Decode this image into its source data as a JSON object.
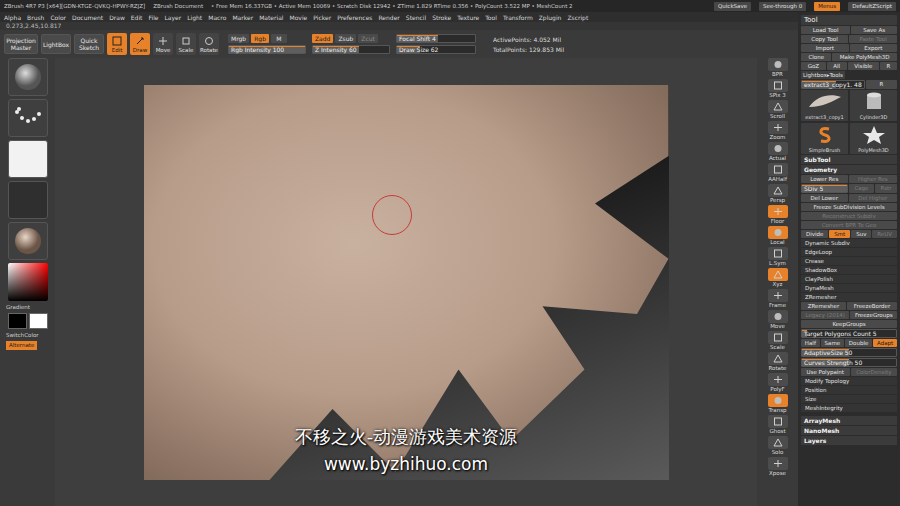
{
  "title_bar": {
    "info": [
      "ZBrush 4R7 P3 [x64][GDN-KTGE-QVKQ-HPWY-RZJZ]",
      "ZBrush Document",
      "• Free Mem 16.337GB • Active Mem 10069 • Scratch Disk 12942 • ZTime 1.829 RTime 0.356 • PolyCount 3.522 MP • MeshCount 2"
    ],
    "buttons": [
      {
        "label": "QuickSave",
        "selected": false
      },
      {
        "label": "See-through 0",
        "selected": false
      },
      {
        "label": "Menus",
        "selected": true
      },
      {
        "label": "DefaultZScript",
        "selected": false
      }
    ]
  },
  "menus": [
    "Alpha",
    "Brush",
    "Color",
    "Document",
    "Draw",
    "Edit",
    "File",
    "Layer",
    "Light",
    "Macro",
    "Marker",
    "Material",
    "Movie",
    "Picker",
    "Preferences",
    "Render",
    "Stencil",
    "Stroke",
    "Texture",
    "Tool",
    "Transform",
    "Zplugin",
    "Zscript"
  ],
  "coordinates": "0.273,2.45,10.817",
  "toolbar": {
    "buttons": [
      {
        "label": "Projection Master",
        "selected": false
      },
      {
        "label": "LightBox",
        "selected": false
      },
      {
        "label": "Quick Sketch",
        "selected": false
      }
    ],
    "modes": [
      {
        "label": "Edit",
        "selected": true
      },
      {
        "label": "Draw",
        "selected": true
      },
      {
        "label": "Move",
        "selected": false
      },
      {
        "label": "Scale",
        "selected": false
      },
      {
        "label": "Rotate",
        "selected": false
      }
    ],
    "color_modes": [
      {
        "label": "Mrgb",
        "selected": false,
        "disabled": false
      },
      {
        "label": "Rgb",
        "selected": true,
        "disabled": false
      },
      {
        "label": "M",
        "selected": false,
        "disabled": false
      }
    ],
    "z_modes": [
      {
        "label": "Zadd",
        "selected": true,
        "disabled": false
      },
      {
        "label": "Zsub",
        "selected": false,
        "disabled": false
      },
      {
        "label": "Zcut",
        "selected": false,
        "disabled": true
      }
    ],
    "focal_shift": {
      "label": "Focal Shift 4",
      "level": 0.52
    },
    "rgb_intensity": {
      "label": "Rgb Intensity 100",
      "level": 1
    },
    "z_intensity": {
      "label": "Z Intensity 60",
      "level": 0.6
    },
    "draw_size": {
      "label": "Draw Size 62",
      "level": 0.3
    },
    "stats": [
      "ActivePoints: 4.052 Mil",
      "TotalPoints: 129.853 Mil"
    ]
  },
  "left_shelf": {
    "gradient_label": "Gradient",
    "switch_label": "SwitchColor",
    "alternate": {
      "label": "Alternate",
      "selected": true
    }
  },
  "viewport": {
    "watermark": [
      "不移之火-动漫游戏美术资源",
      "www.byzhihuo.com"
    ]
  },
  "right_shelf": [
    {
      "label": "BPR",
      "selected": false
    },
    {
      "label": "SPix 3",
      "selected": false
    },
    {
      "label": "Scroll",
      "selected": false
    },
    {
      "label": "Zoom",
      "selected": false
    },
    {
      "label": "Actual",
      "selected": false
    },
    {
      "label": "AAHalf",
      "selected": false
    },
    {
      "label": "Persp",
      "selected": false
    },
    {
      "label": "Floor",
      "selected": true
    },
    {
      "label": "Local",
      "selected": true
    },
    {
      "label": "L.Sym",
      "selected": false
    },
    {
      "label": "Xyz",
      "selected": true
    },
    {
      "label": "Frame",
      "selected": false
    },
    {
      "label": "Move",
      "selected": false
    },
    {
      "label": "Scale",
      "selected": false
    },
    {
      "label": "Rotate",
      "selected": false
    },
    {
      "label": "PolyF",
      "selected": false
    },
    {
      "label": "Transp",
      "selected": true
    },
    {
      "label": "Ghost",
      "selected": false
    },
    {
      "label": "Solo",
      "selected": false
    },
    {
      "label": "Xpose",
      "selected": false
    }
  ],
  "tool_panel": {
    "title": "Tool",
    "rows": [
      {
        "kind": "buttons",
        "items": [
          {
            "label": "Load Tool",
            "selected": false,
            "disabled": false
          },
          {
            "label": "Save As",
            "selected": false,
            "disabled": false
          }
        ]
      },
      {
        "kind": "buttons",
        "items": [
          {
            "label": "Copy Tool",
            "selected": false,
            "disabled": false
          },
          {
            "label": "Paste Tool",
            "selected": false,
            "disabled": true
          }
        ]
      },
      {
        "kind": "buttons",
        "items": [
          {
            "label": "Import",
            "selected": false,
            "disabled": false
          },
          {
            "label": "Export",
            "selected": false,
            "disabled": false
          }
        ]
      },
      {
        "kind": "buttons",
        "items": [
          {
            "label": "Clone",
            "selected": false,
            "disabled": false
          },
          {
            "label": "Make PolyMesh3D",
            "selected": false,
            "disabled": false
          }
        ]
      },
      {
        "kind": "buttons",
        "items": [
          {
            "label": "GoZ",
            "selected": false,
            "disabled": false
          },
          {
            "label": "All",
            "selected": false,
            "disabled": false
          },
          {
            "label": "Visible",
            "selected": false,
            "disabled": false
          },
          {
            "label": "R",
            "selected": false,
            "disabled": false
          }
        ]
      },
      {
        "kind": "link",
        "label": "Lightbox▸Tools"
      },
      {
        "kind": "slider",
        "label": "extract3_copy1. 48",
        "level": 0.55,
        "items": [
          {
            "label": "R",
            "selected": false,
            "disabled": false
          }
        ]
      },
      {
        "kind": "thumbs",
        "items": [
          {
            "label": "extract3_copy1",
            "kind": "feather"
          },
          {
            "label": "Cylinder3D",
            "kind": "cylinder"
          },
          {
            "label": "SimpleBrush",
            "kind": "simple"
          },
          {
            "label": "PolyMesh3D",
            "kind": "star"
          }
        ]
      },
      {
        "kind": "header",
        "label": "SubTool"
      },
      {
        "kind": "header",
        "label": "Geometry"
      },
      {
        "kind": "buttons",
        "items": [
          {
            "label": "Lower Res",
            "selected": false,
            "disabled": false
          },
          {
            "label": "Higher Res",
            "selected": false,
            "disabled": true
          }
        ]
      },
      {
        "kind": "slider",
        "label": "SDiv 5",
        "level": 1,
        "items": [
          {
            "label": "Cage",
            "selected": false,
            "disabled": true
          },
          {
            "label": "Rstr",
            "selected": false,
            "disabled": true
          }
        ]
      },
      {
        "kind": "buttons",
        "items": [
          {
            "label": "Del Lower",
            "selected": false,
            "disabled": false
          },
          {
            "label": "Del Higher",
            "selected": false,
            "disabled": true
          }
        ]
      },
      {
        "kind": "buttons",
        "items": [
          {
            "label": "Freeze SubDivision Levels",
            "selected": false,
            "disabled": false
          }
        ]
      },
      {
        "kind": "buttons",
        "items": [
          {
            "label": "Reconstruct Subdiv",
            "selected": false,
            "disabled": true
          }
        ]
      },
      {
        "kind": "buttons",
        "items": [
          {
            "label": "Convert BPR To Geo",
            "selected": false,
            "disabled": true
          }
        ]
      },
      {
        "kind": "buttons",
        "items": [
          {
            "label": "Divide",
            "selected": false,
            "disabled": false
          },
          {
            "label": "Smt",
            "selected": true,
            "disabled": false
          },
          {
            "label": "Suv",
            "selected": false,
            "disabled": false
          },
          {
            "label": "ReUV",
            "selected": false,
            "disabled": true
          }
        ]
      },
      {
        "kind": "sub",
        "label": "Dynamic Subdiv"
      },
      {
        "kind": "sub",
        "label": "EdgeLoop"
      },
      {
        "kind": "sub",
        "label": "Crease"
      },
      {
        "kind": "sub",
        "label": "ShadowBox"
      },
      {
        "kind": "sub",
        "label": "ClayPolish"
      },
      {
        "kind": "sub",
        "label": "DynaMesh"
      },
      {
        "kind": "sub",
        "label": "ZRemesher"
      },
      {
        "kind": "buttons",
        "items": [
          {
            "label": "ZRemesher",
            "selected": false,
            "disabled": false
          },
          {
            "label": "FreezeBorder",
            "selected": false,
            "disabled": false
          }
        ]
      },
      {
        "kind": "buttons",
        "items": [
          {
            "label": "Legacy (2014)",
            "selected": false,
            "disabled": true
          },
          {
            "label": "FreezeGroups",
            "selected": false,
            "disabled": false
          }
        ]
      },
      {
        "kind": "buttons",
        "items": [
          {
            "label": "KeepGroups",
            "selected": false,
            "disabled": false
          }
        ]
      },
      {
        "kind": "slider",
        "label": "Target Polygons Count 5",
        "level": 0.05,
        "items": []
      },
      {
        "kind": "buttons",
        "items": [
          {
            "label": "Half",
            "selected": false,
            "disabled": false
          },
          {
            "label": "Same",
            "selected": false,
            "disabled": false
          },
          {
            "label": "Double",
            "selected": false,
            "disabled": false
          },
          {
            "label": "Adapt",
            "selected": true,
            "disabled": false
          }
        ]
      },
      {
        "kind": "slider",
        "label": "AdaptiveSize 50",
        "level": 0.5,
        "items": []
      },
      {
        "kind": "slider",
        "label": "Curves Strength 50",
        "level": 0.5,
        "items": []
      },
      {
        "kind": "buttons",
        "items": [
          {
            "label": "Use Polypaint",
            "selected": false,
            "disabled": false
          },
          {
            "label": "ColorDensity",
            "selected": false,
            "disabled": true
          }
        ]
      },
      {
        "kind": "sub",
        "label": "Modify Topology"
      },
      {
        "kind": "sub",
        "label": "Position"
      },
      {
        "kind": "sub",
        "label": "Size"
      },
      {
        "kind": "sub",
        "label": "MeshIntegrity"
      }
    ],
    "footer": [
      "ArrayMesh",
      "NanoMesh",
      "Layers"
    ]
  }
}
